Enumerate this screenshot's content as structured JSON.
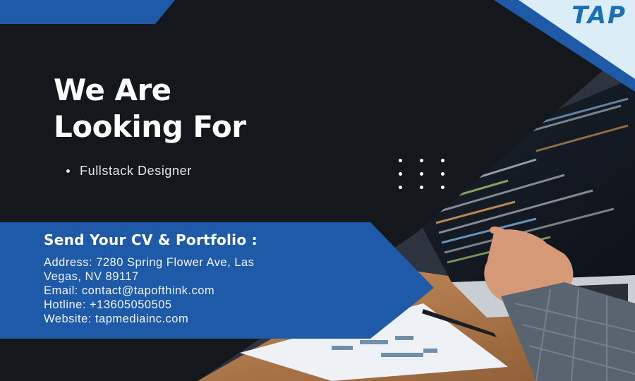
{
  "brand": {
    "logo_text": "TAP",
    "accent_color": "#1e5aa8",
    "logo_color": "#1a6fb5"
  },
  "headline": {
    "line1": "We Are",
    "line2": "Looking For"
  },
  "roles": [
    "Fullstack Designer"
  ],
  "contact": {
    "title": "Send Your CV & Portfolio :",
    "address_line1": "Address: 7280 Spring Flower Ave, Las",
    "address_line2": "Vegas, NV 89117",
    "email": "Email: contact@tapofthink.com",
    "hotline": "Hotline: +13605050505",
    "website": "Website: tapmediainc.com"
  },
  "colors": {
    "background": "#14171c",
    "band_blue": "#1e5aa8",
    "light_blue": "#dbeef8",
    "text": "#ffffff"
  }
}
